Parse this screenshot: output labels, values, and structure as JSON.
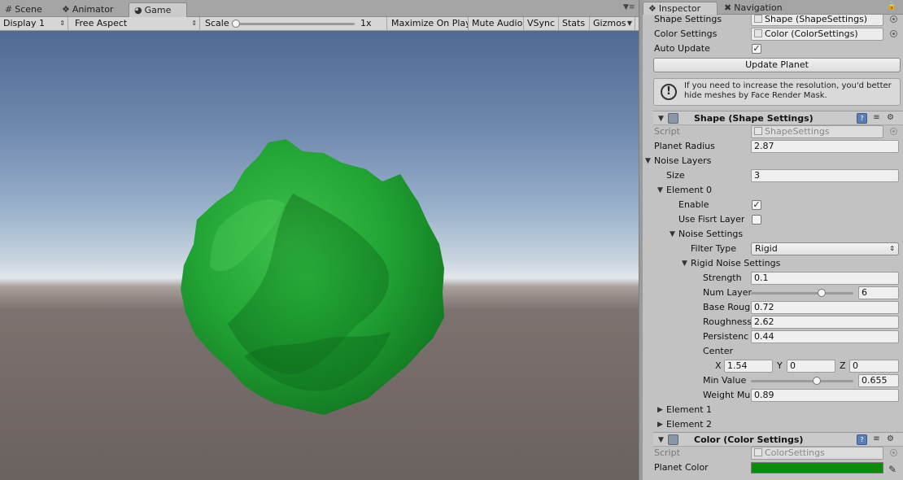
{
  "left_tabs": {
    "scene": "Scene",
    "animator": "Animator",
    "game": "Game"
  },
  "game_toolbar": {
    "display": "Display 1",
    "aspect": "Free Aspect",
    "scale_label": "Scale",
    "scale_value": "1x",
    "maximize": "Maximize On Play",
    "mute": "Mute Audio",
    "vsync": "VSync",
    "stats": "Stats",
    "gizmos": "Gizmos"
  },
  "right_tabs": {
    "inspector": "Inspector",
    "navigation": "Navigation"
  },
  "planet_component": {
    "shape_settings_label": "Shape Settings",
    "shape_settings_value": "Shape (ShapeSettings)",
    "color_settings_label": "Color Settings",
    "color_settings_value": "Color (ColorSettings)",
    "auto_update_label": "Auto Update",
    "auto_update": true,
    "update_button": "Update Planet",
    "help_text": "If you need to increase the resolution, you'd better hide meshes by Face Render Mask."
  },
  "shape_section": {
    "title": "Shape (Shape Settings)",
    "script_label": "Script",
    "script_value": "ShapeSettings",
    "planet_radius_label": "Planet Radius",
    "planet_radius": "2.87",
    "noise_layers_label": "Noise Layers",
    "size_label": "Size",
    "size": "3",
    "element0_label": "Element 0",
    "enable_label": "Enable",
    "enable": true,
    "use_first_layer_label": "Use Fisrt Layer",
    "use_first_layer": false,
    "noise_settings_label": "Noise Settings",
    "filter_type_label": "Filter Type",
    "filter_type": "Rigid",
    "rigid_label": "Rigid Noise Settings",
    "strength_label": "Strength",
    "strength": "0.1",
    "num_layers_label": "Num Layer",
    "num_layers": "6",
    "num_layers_fraction": 0.69,
    "base_roughness_label": "Base Roug",
    "base_roughness": "0.72",
    "roughness_label": "Roughness",
    "roughness": "2.62",
    "persistence_label": "Persistenc",
    "persistence": "0.44",
    "center_label": "Center",
    "center_x_label": "X",
    "center_x": "1.54",
    "center_y_label": "Y",
    "center_y": "0",
    "center_z_label": "Z",
    "center_z": "0",
    "min_value_label": "Min Value",
    "min_value": "0.655",
    "min_value_fraction": 0.64,
    "weight_label": "Weight Mu",
    "weight": "0.89",
    "element1_label": "Element 1",
    "element2_label": "Element 2"
  },
  "color_section": {
    "title": "Color (Color Settings)",
    "script_label": "Script",
    "script_value": "ColorSettings",
    "planet_color_label": "Planet Color",
    "planet_color": "#0c8a0c"
  },
  "colors": {
    "planet_green": "#21a33a"
  }
}
